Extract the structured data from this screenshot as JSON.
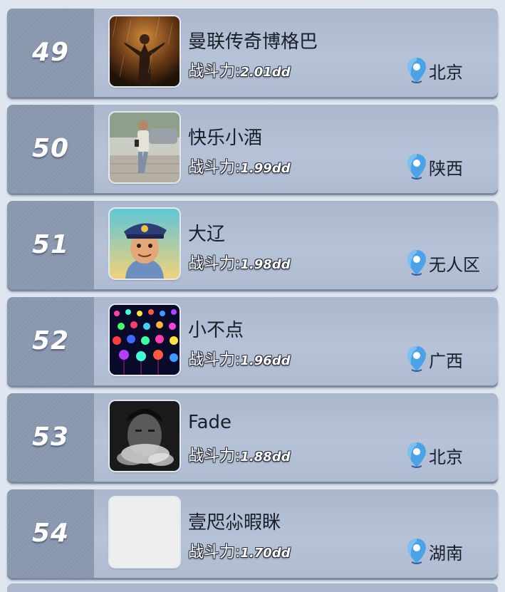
{
  "leaderboard": {
    "power_label": "战斗力:",
    "pin_icon": "map-pin-icon",
    "pin_color": "#4aa3e8",
    "entries": [
      {
        "rank": "49",
        "name": "曼联传奇博格巴",
        "power": "2.01dd",
        "location": "北京",
        "avatar": "avatar-rainy-man"
      },
      {
        "rank": "50",
        "name": "快乐小酒",
        "power": "1.99dd",
        "location": "陕西",
        "avatar": "avatar-street-photo"
      },
      {
        "rank": "51",
        "name": "大辽",
        "power": "1.98dd",
        "location": "无人区",
        "avatar": "avatar-cartoon-captain"
      },
      {
        "rank": "52",
        "name": "小不点",
        "power": "1.96dd",
        "location": "广西",
        "avatar": "avatar-lights"
      },
      {
        "rank": "53",
        "name": "Fade",
        "power": "1.88dd",
        "location": "北京",
        "avatar": "avatar-smoke-portrait"
      },
      {
        "rank": "54",
        "name": "壹咫尛暇眯",
        "power": "1.70dd",
        "location": "湖南",
        "avatar": "avatar-blank"
      }
    ]
  }
}
